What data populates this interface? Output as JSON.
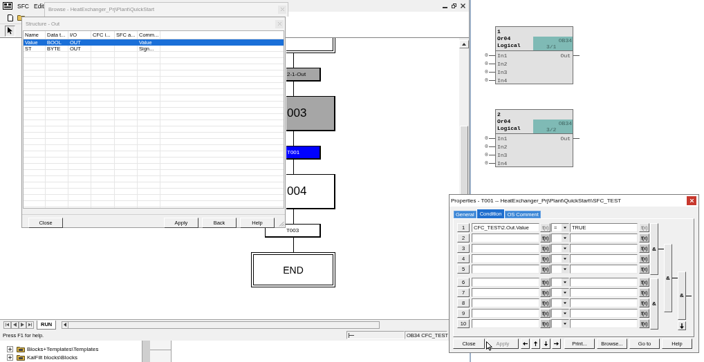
{
  "sfc_window": {
    "menu": [
      "SFC",
      "Edit"
    ],
    "chart": {
      "elements": [
        {
          "kind": "terminal",
          "shaded": false,
          "selected": false
        },
        {
          "kind": "transition",
          "label": "2-1-Out",
          "shaded": true,
          "selected": false
        },
        {
          "kind": "step",
          "label": "003",
          "shaded": true,
          "selected": false
        },
        {
          "kind": "transition",
          "label": "T001",
          "shaded": false,
          "selected": true
        },
        {
          "kind": "step",
          "label": "004",
          "shaded": false,
          "selected": false
        },
        {
          "kind": "transition",
          "label": "T003",
          "shaded": false,
          "selected": false
        },
        {
          "kind": "terminal",
          "label": "END",
          "shaded": false,
          "selected": false
        }
      ]
    },
    "sheet_tabs": [
      {
        "label": "RUN",
        "selected": true
      }
    ],
    "status_bar": {
      "help": "Press F1 for help.",
      "location": "OB34 CFC_TEST"
    }
  },
  "browse_window": {
    "title": "Browse - HeatExchanger_Prj\\Plant\\QuickStart"
  },
  "structure_window": {
    "title": "Structure - Out",
    "columns": [
      "Name",
      "Data t...",
      "I/O",
      "CFC i...",
      "SFC a...",
      "Comm..."
    ],
    "rows": [
      {
        "name": "Value",
        "column_2": "BOOL",
        "io": "OUT",
        "column_6": "Value",
        "selected": true
      },
      {
        "name": "ST",
        "column_2": "BYTE",
        "io": "OUT",
        "column_6": "Sign...",
        "selected": false
      }
    ],
    "buttons": [
      "Close",
      "Apply",
      "Back",
      "Help"
    ]
  },
  "cfc_chart": {
    "blocks": [
      {
        "number": "1",
        "type": "Or04",
        "family": "Logical",
        "task": "OB34",
        "sequence": "3/1",
        "inputs": [
          {
            "name": "In1",
            "value": "0"
          },
          {
            "name": "In2",
            "value": "0"
          },
          {
            "name": "In3",
            "value": "0"
          },
          {
            "name": "In4",
            "value": "0"
          }
        ],
        "outputs": [
          "Out"
        ]
      },
      {
        "number": "2",
        "type": "Or04",
        "family": "Logical",
        "task": "OB34",
        "sequence": "3/2",
        "inputs": [
          {
            "name": "In1",
            "value": "0"
          },
          {
            "name": "In2",
            "value": "0"
          },
          {
            "name": "In3",
            "value": "0"
          },
          {
            "name": "In4",
            "value": "0"
          }
        ],
        "outputs": [
          "Out"
        ]
      }
    ]
  },
  "properties_dialog": {
    "title": "Properties - T001 -- HeatExchanger_Prj\\Plant\\QuickStart\\\\SFC_TEST",
    "tabs": [
      {
        "label": "General",
        "selected": false
      },
      {
        "label": "Condition",
        "selected": true
      },
      {
        "label": "OS Comment",
        "selected": false
      }
    ],
    "conditions": [
      {
        "number": "1",
        "operand_1": "CFC_TEST\\2.Out.Value",
        "operator": "=",
        "operand_2": "TRUE",
        "function_buttons": [
          "f(x)",
          "f(x)"
        ],
        "function_buttons_disabled": true
      },
      {
        "number": "2",
        "function_buttons": [
          "f(x)",
          "f(x)"
        ],
        "function_buttons_disabled": false
      },
      {
        "number": "3",
        "function_buttons": [
          "f(x)",
          "f(x)"
        ],
        "function_buttons_disabled": false
      },
      {
        "number": "4",
        "function_buttons": [
          "f(x)",
          "f(x)"
        ],
        "function_buttons_disabled": false
      },
      {
        "number": "5",
        "function_buttons": [
          "f(x)",
          "f(x)"
        ],
        "function_buttons_disabled": false
      },
      {
        "number": "6",
        "function_buttons": [
          "f(x)",
          "f(x)"
        ],
        "function_buttons_disabled": false
      },
      {
        "number": "7",
        "function_buttons": [
          "f(x)",
          "f(x)"
        ],
        "function_buttons_disabled": false
      },
      {
        "number": "8",
        "function_buttons": [
          "f(x)",
          "f(x)"
        ],
        "function_buttons_disabled": false
      },
      {
        "number": "9",
        "function_buttons": [
          "f(x)",
          "f(x)"
        ],
        "function_buttons_disabled": false
      },
      {
        "number": "10",
        "function_buttons": [
          "f(x)",
          "f(x)"
        ],
        "function_buttons_disabled": false
      }
    ],
    "logic_gates": [
      "&",
      "&",
      "&",
      "&"
    ],
    "left_buttons": [
      {
        "label": "Close",
        "disabled": false
      },
      {
        "label": "Apply",
        "disabled": true
      }
    ],
    "right_buttons": [
      {
        "label": "Print...",
        "disabled": false
      },
      {
        "label": "Browse...",
        "disabled": false
      },
      {
        "label": "Go to",
        "disabled": false
      },
      {
        "label": "Help",
        "disabled": false
      }
    ]
  },
  "tree": {
    "items": [
      {
        "label": "Blocks+Templates\\Templates",
        "expanded": false
      },
      {
        "label": "KalFilt blocks\\Blocks",
        "expanded": false
      }
    ]
  }
}
